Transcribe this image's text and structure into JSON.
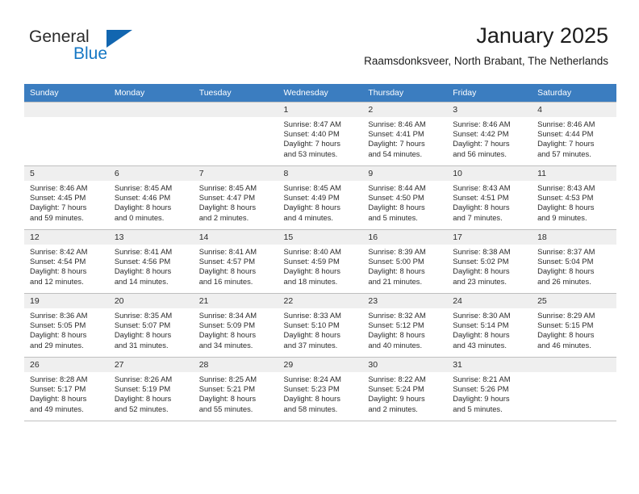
{
  "brand": {
    "name_part1": "General",
    "name_part2": "Blue"
  },
  "header": {
    "title": "January 2025",
    "subtitle": "Raamsdonksveer, North Brabant, The Netherlands"
  },
  "colors": {
    "header_row": "#3b7dc0",
    "brand_blue": "#1577c4",
    "daynum_bg": "#efefef",
    "grid_line": "#bfbfbf"
  },
  "weekdays": [
    "Sunday",
    "Monday",
    "Tuesday",
    "Wednesday",
    "Thursday",
    "Friday",
    "Saturday"
  ],
  "weeks": [
    [
      {
        "day": "",
        "empty": true
      },
      {
        "day": "",
        "empty": true
      },
      {
        "day": "",
        "empty": true
      },
      {
        "day": "1",
        "sunrise": "Sunrise: 8:47 AM",
        "sunset": "Sunset: 4:40 PM",
        "daylight1": "Daylight: 7 hours",
        "daylight2": "and 53 minutes."
      },
      {
        "day": "2",
        "sunrise": "Sunrise: 8:46 AM",
        "sunset": "Sunset: 4:41 PM",
        "daylight1": "Daylight: 7 hours",
        "daylight2": "and 54 minutes."
      },
      {
        "day": "3",
        "sunrise": "Sunrise: 8:46 AM",
        "sunset": "Sunset: 4:42 PM",
        "daylight1": "Daylight: 7 hours",
        "daylight2": "and 56 minutes."
      },
      {
        "day": "4",
        "sunrise": "Sunrise: 8:46 AM",
        "sunset": "Sunset: 4:44 PM",
        "daylight1": "Daylight: 7 hours",
        "daylight2": "and 57 minutes."
      }
    ],
    [
      {
        "day": "5",
        "sunrise": "Sunrise: 8:46 AM",
        "sunset": "Sunset: 4:45 PM",
        "daylight1": "Daylight: 7 hours",
        "daylight2": "and 59 minutes."
      },
      {
        "day": "6",
        "sunrise": "Sunrise: 8:45 AM",
        "sunset": "Sunset: 4:46 PM",
        "daylight1": "Daylight: 8 hours",
        "daylight2": "and 0 minutes."
      },
      {
        "day": "7",
        "sunrise": "Sunrise: 8:45 AM",
        "sunset": "Sunset: 4:47 PM",
        "daylight1": "Daylight: 8 hours",
        "daylight2": "and 2 minutes."
      },
      {
        "day": "8",
        "sunrise": "Sunrise: 8:45 AM",
        "sunset": "Sunset: 4:49 PM",
        "daylight1": "Daylight: 8 hours",
        "daylight2": "and 4 minutes."
      },
      {
        "day": "9",
        "sunrise": "Sunrise: 8:44 AM",
        "sunset": "Sunset: 4:50 PM",
        "daylight1": "Daylight: 8 hours",
        "daylight2": "and 5 minutes."
      },
      {
        "day": "10",
        "sunrise": "Sunrise: 8:43 AM",
        "sunset": "Sunset: 4:51 PM",
        "daylight1": "Daylight: 8 hours",
        "daylight2": "and 7 minutes."
      },
      {
        "day": "11",
        "sunrise": "Sunrise: 8:43 AM",
        "sunset": "Sunset: 4:53 PM",
        "daylight1": "Daylight: 8 hours",
        "daylight2": "and 9 minutes."
      }
    ],
    [
      {
        "day": "12",
        "sunrise": "Sunrise: 8:42 AM",
        "sunset": "Sunset: 4:54 PM",
        "daylight1": "Daylight: 8 hours",
        "daylight2": "and 12 minutes."
      },
      {
        "day": "13",
        "sunrise": "Sunrise: 8:41 AM",
        "sunset": "Sunset: 4:56 PM",
        "daylight1": "Daylight: 8 hours",
        "daylight2": "and 14 minutes."
      },
      {
        "day": "14",
        "sunrise": "Sunrise: 8:41 AM",
        "sunset": "Sunset: 4:57 PM",
        "daylight1": "Daylight: 8 hours",
        "daylight2": "and 16 minutes."
      },
      {
        "day": "15",
        "sunrise": "Sunrise: 8:40 AM",
        "sunset": "Sunset: 4:59 PM",
        "daylight1": "Daylight: 8 hours",
        "daylight2": "and 18 minutes."
      },
      {
        "day": "16",
        "sunrise": "Sunrise: 8:39 AM",
        "sunset": "Sunset: 5:00 PM",
        "daylight1": "Daylight: 8 hours",
        "daylight2": "and 21 minutes."
      },
      {
        "day": "17",
        "sunrise": "Sunrise: 8:38 AM",
        "sunset": "Sunset: 5:02 PM",
        "daylight1": "Daylight: 8 hours",
        "daylight2": "and 23 minutes."
      },
      {
        "day": "18",
        "sunrise": "Sunrise: 8:37 AM",
        "sunset": "Sunset: 5:04 PM",
        "daylight1": "Daylight: 8 hours",
        "daylight2": "and 26 minutes."
      }
    ],
    [
      {
        "day": "19",
        "sunrise": "Sunrise: 8:36 AM",
        "sunset": "Sunset: 5:05 PM",
        "daylight1": "Daylight: 8 hours",
        "daylight2": "and 29 minutes."
      },
      {
        "day": "20",
        "sunrise": "Sunrise: 8:35 AM",
        "sunset": "Sunset: 5:07 PM",
        "daylight1": "Daylight: 8 hours",
        "daylight2": "and 31 minutes."
      },
      {
        "day": "21",
        "sunrise": "Sunrise: 8:34 AM",
        "sunset": "Sunset: 5:09 PM",
        "daylight1": "Daylight: 8 hours",
        "daylight2": "and 34 minutes."
      },
      {
        "day": "22",
        "sunrise": "Sunrise: 8:33 AM",
        "sunset": "Sunset: 5:10 PM",
        "daylight1": "Daylight: 8 hours",
        "daylight2": "and 37 minutes."
      },
      {
        "day": "23",
        "sunrise": "Sunrise: 8:32 AM",
        "sunset": "Sunset: 5:12 PM",
        "daylight1": "Daylight: 8 hours",
        "daylight2": "and 40 minutes."
      },
      {
        "day": "24",
        "sunrise": "Sunrise: 8:30 AM",
        "sunset": "Sunset: 5:14 PM",
        "daylight1": "Daylight: 8 hours",
        "daylight2": "and 43 minutes."
      },
      {
        "day": "25",
        "sunrise": "Sunrise: 8:29 AM",
        "sunset": "Sunset: 5:15 PM",
        "daylight1": "Daylight: 8 hours",
        "daylight2": "and 46 minutes."
      }
    ],
    [
      {
        "day": "26",
        "sunrise": "Sunrise: 8:28 AM",
        "sunset": "Sunset: 5:17 PM",
        "daylight1": "Daylight: 8 hours",
        "daylight2": "and 49 minutes."
      },
      {
        "day": "27",
        "sunrise": "Sunrise: 8:26 AM",
        "sunset": "Sunset: 5:19 PM",
        "daylight1": "Daylight: 8 hours",
        "daylight2": "and 52 minutes."
      },
      {
        "day": "28",
        "sunrise": "Sunrise: 8:25 AM",
        "sunset": "Sunset: 5:21 PM",
        "daylight1": "Daylight: 8 hours",
        "daylight2": "and 55 minutes."
      },
      {
        "day": "29",
        "sunrise": "Sunrise: 8:24 AM",
        "sunset": "Sunset: 5:23 PM",
        "daylight1": "Daylight: 8 hours",
        "daylight2": "and 58 minutes."
      },
      {
        "day": "30",
        "sunrise": "Sunrise: 8:22 AM",
        "sunset": "Sunset: 5:24 PM",
        "daylight1": "Daylight: 9 hours",
        "daylight2": "and 2 minutes."
      },
      {
        "day": "31",
        "sunrise": "Sunrise: 8:21 AM",
        "sunset": "Sunset: 5:26 PM",
        "daylight1": "Daylight: 9 hours",
        "daylight2": "and 5 minutes."
      },
      {
        "day": "",
        "empty": true
      }
    ]
  ]
}
